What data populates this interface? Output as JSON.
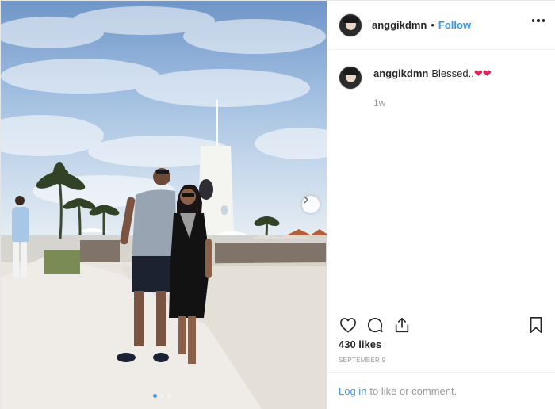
{
  "post": {
    "photo": {
      "alt": "",
      "carousel_dots": 3,
      "active_dot": 0
    },
    "header": {
      "username": "anggikdmn",
      "separator": "•",
      "follow_label": "Follow"
    },
    "caption": {
      "username": "anggikdmn",
      "text": "Blessed..",
      "emoji": "❤❤",
      "time_ago": "1w"
    },
    "likes": "430 likes",
    "date": "SEPTEMBER 9",
    "login_bar": {
      "link": "Log in",
      "text": "to like or comment."
    },
    "colors": {
      "link_blue": "#3897f0",
      "text": "#262626",
      "muted": "#999999",
      "heart_red": "#e0245e"
    },
    "icons": [
      "heart-icon",
      "comment-icon",
      "share-icon",
      "bookmark-icon",
      "more-options-icon",
      "chevron-right-icon"
    ]
  }
}
